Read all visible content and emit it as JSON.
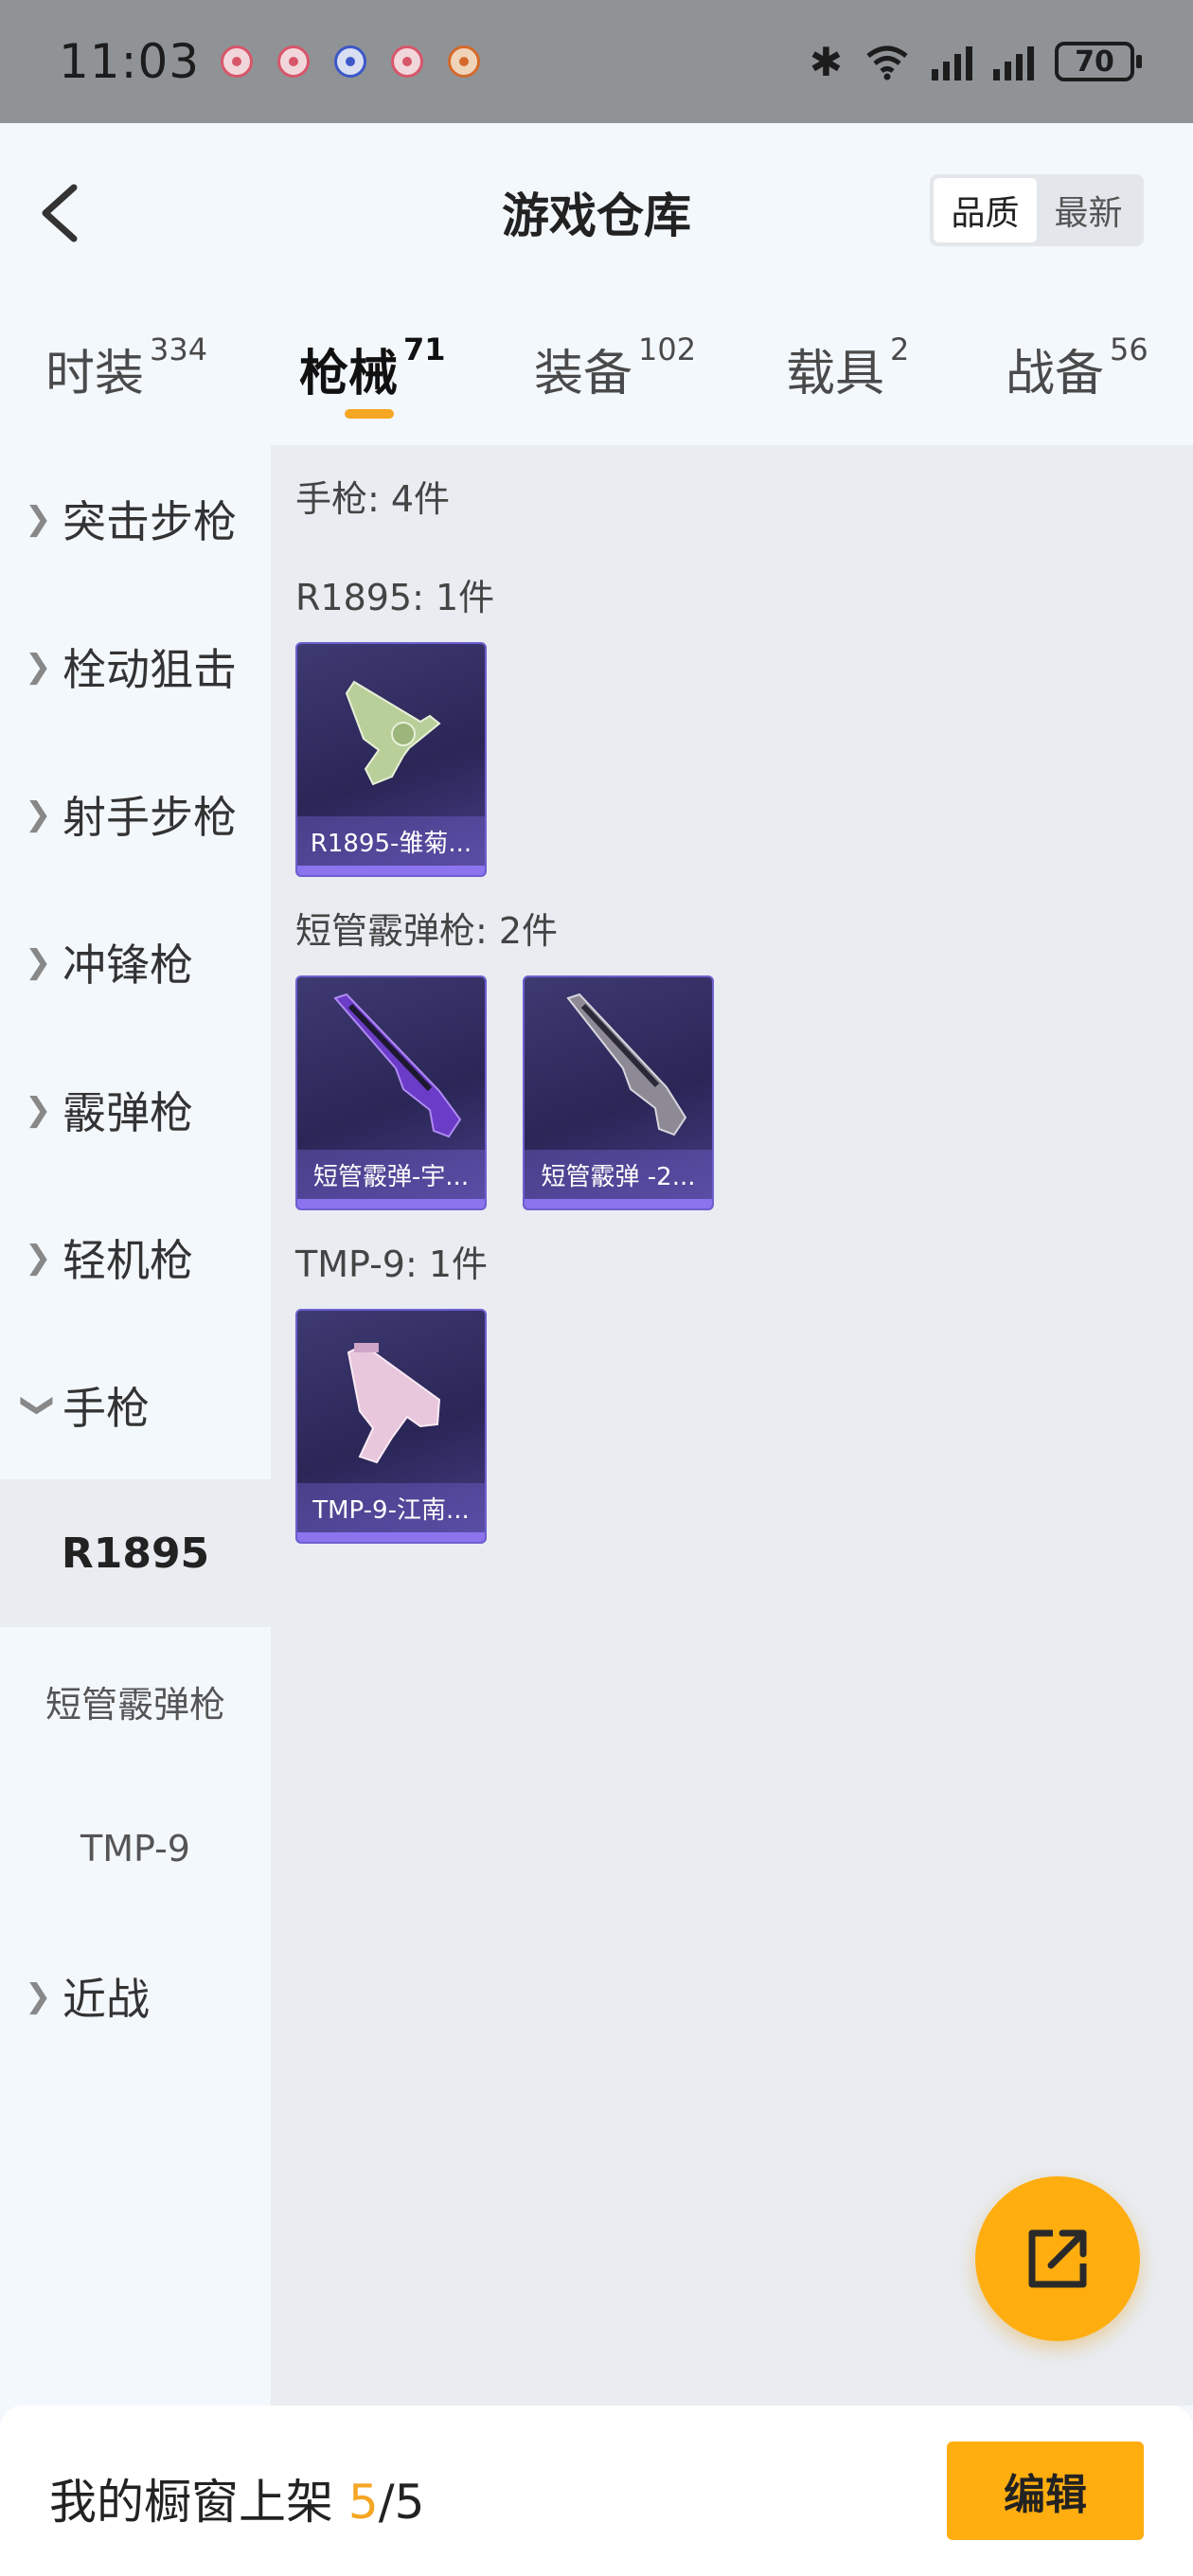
{
  "status_bar": {
    "time": "11:03",
    "battery": "70"
  },
  "header": {
    "title": "游戏仓库",
    "sort_options": [
      "品质",
      "最新"
    ]
  },
  "tabs": [
    {
      "label": "时装",
      "count": "334"
    },
    {
      "label": "枪械",
      "count": "71"
    },
    {
      "label": "装备",
      "count": "102"
    },
    {
      "label": "载具",
      "count": "2"
    },
    {
      "label": "战备",
      "count": "56"
    }
  ],
  "sidebar": {
    "items": [
      "突击步枪",
      "栓动狙击",
      "射手步枪",
      "冲锋枪",
      "霰弹枪",
      "轻机枪",
      "手枪"
    ],
    "sub_items": [
      "R1895",
      "短管霰弹枪",
      "TMP-9"
    ],
    "last_item": "近战"
  },
  "main": {
    "summary": "手枪: 4件",
    "groups": [
      {
        "label": "R1895: 1件",
        "cards": [
          "R1895-雏菊..."
        ]
      },
      {
        "label": "短管霰弹枪: 2件",
        "cards": [
          "短管霰弹-宇...",
          "短管霰弹 -2..."
        ]
      },
      {
        "label": "TMP-9: 1件",
        "cards": [
          "TMP-9-江南..."
        ]
      }
    ]
  },
  "bottom": {
    "label": "我的橱窗上架 ",
    "current": "5",
    "total": "/5",
    "edit_label": "编辑"
  },
  "colors": {
    "accent": "#f5a623",
    "fab": "#ffad0f",
    "card_bg": "#2a2656"
  }
}
